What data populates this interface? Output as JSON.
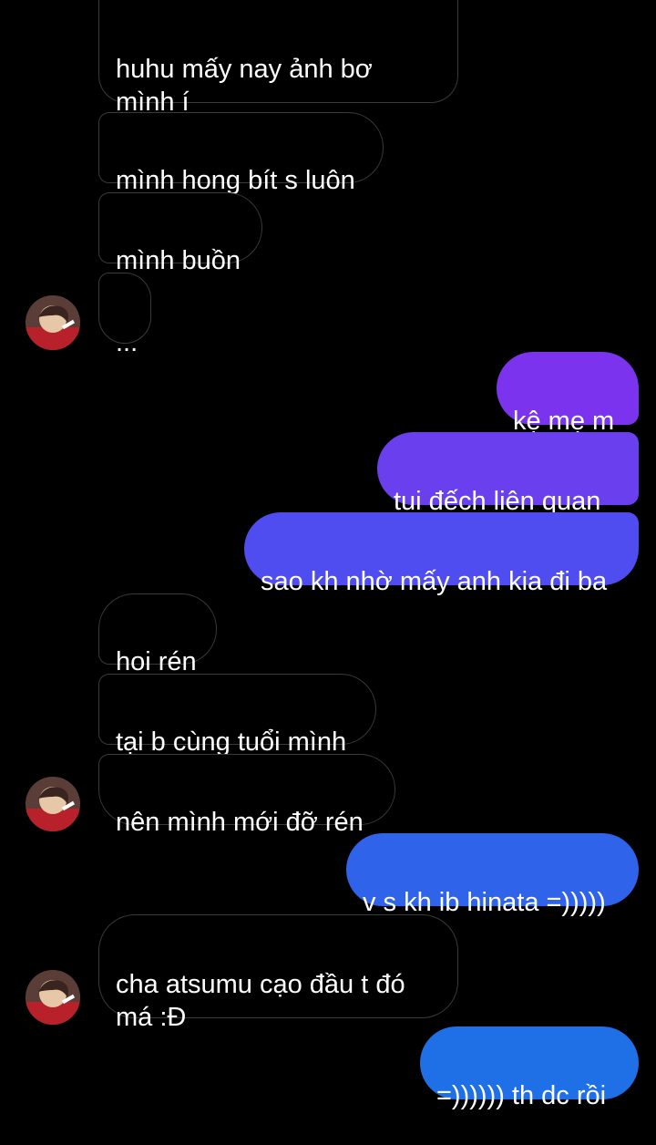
{
  "colors": {
    "incoming_bg": "#000000",
    "incoming_border": "#3a3a3c",
    "outgoing_purple": "#7c3aed",
    "outgoing_violet": "#6a40ee",
    "outgoing_indigo": "#4f4cf0",
    "outgoing_blue": "#2f63ea",
    "outgoing_blue2": "#1f6fe6"
  },
  "avatar_icon": "profile-avatar-icon",
  "messages": [
    {
      "from": "them",
      "text": "huhu mấy nay ảnh bơ\nmình í"
    },
    {
      "from": "them",
      "text": "mình hong bít s luôn"
    },
    {
      "from": "them",
      "text": "mình buồn"
    },
    {
      "from": "them",
      "text": "..."
    },
    {
      "from": "me",
      "text": "kệ mẹ m"
    },
    {
      "from": "me",
      "text": "tui đếch liên quan"
    },
    {
      "from": "me",
      "text": "sao kh nhờ mấy anh kia đi ba"
    },
    {
      "from": "them",
      "text": "hoi rén"
    },
    {
      "from": "them",
      "text": "tại b cùng tuổi mình"
    },
    {
      "from": "them",
      "text": "nên mình mới đỡ rén"
    },
    {
      "from": "me",
      "text": "v s kh ib hinata =)))))"
    },
    {
      "from": "them",
      "text": "cha atsumu cạo đầu t đó\nmá :Đ"
    },
    {
      "from": "me",
      "text": "=)))))) th dc rồi"
    }
  ]
}
